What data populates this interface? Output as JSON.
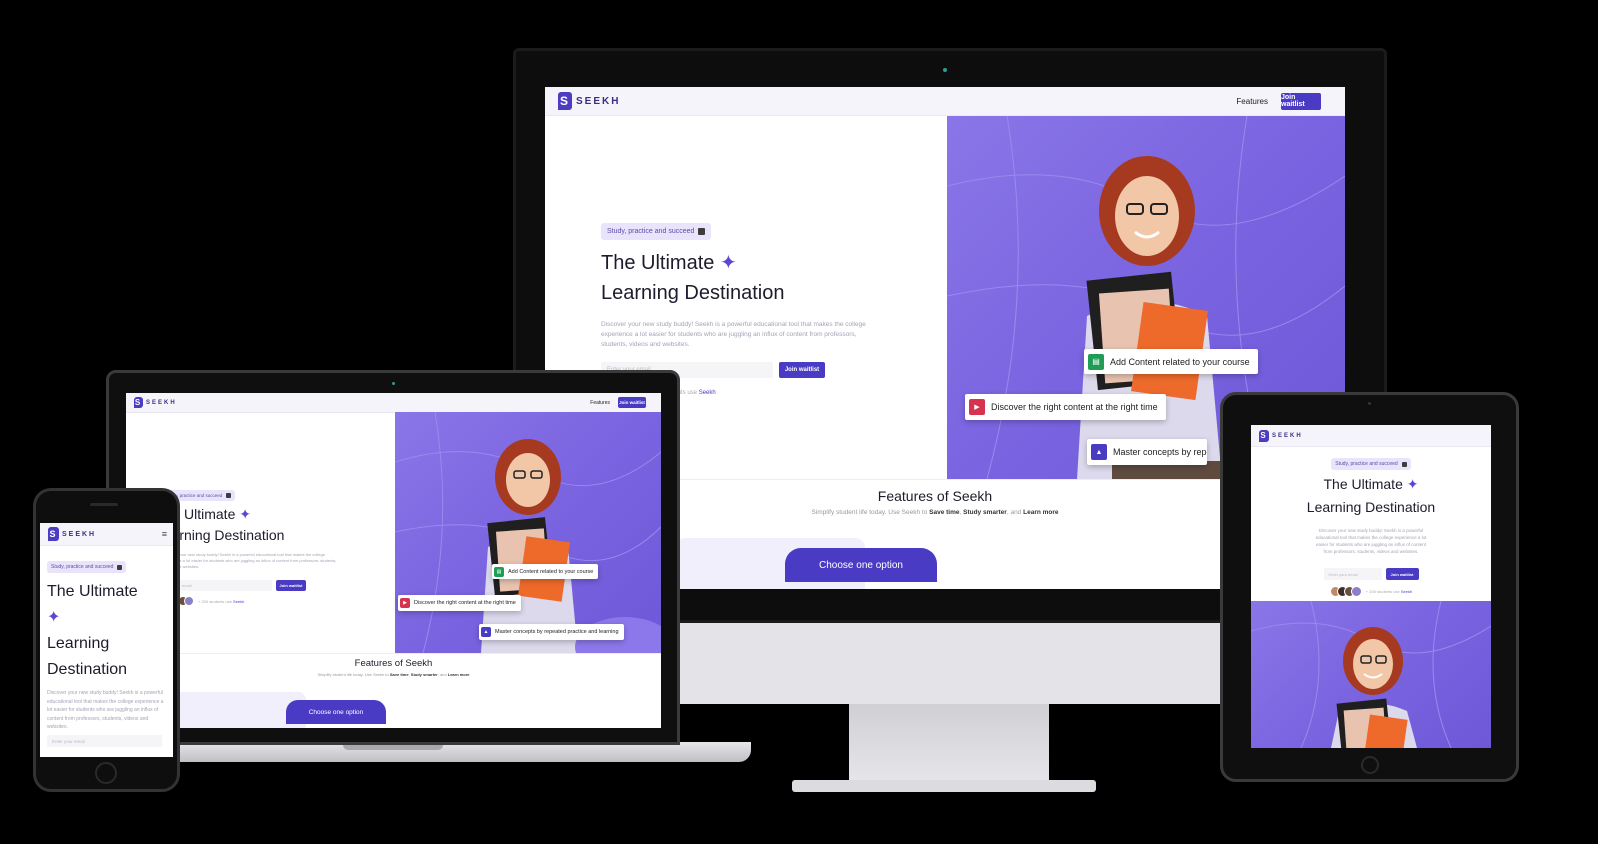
{
  "brand": {
    "mark": "S",
    "name": "SEEKH"
  },
  "nav": {
    "features": "Features",
    "join_button": "Join waitlist",
    "menu_icon": "hamburger-icon"
  },
  "hero": {
    "pill": "Study, practice and succeed",
    "pill_icon": "book-icon",
    "title_line1": "The Ultimate",
    "title_line2": "Learning Destination",
    "title_word_learning": "Learning",
    "title_word_destination": "Destination",
    "star_glyph": "✦",
    "description": "Discover your new study buddy! Seekh is a powerful educational tool that makes the college experience a lot easier for students who are juggling an influx of content from professors, students, videos and websites.",
    "email_placeholder": "Enter your email",
    "join_button": "Join waitlist",
    "students_prefix": "+ 200 students use",
    "students_brand": "Seekh",
    "students_partial": "dents use",
    "laptop_placeholder_fragment": "email"
  },
  "cards": {
    "add_content": "Add Content related to your course",
    "discover": "Discover the right content at the right time",
    "master": "Master concepts by repeated practice and learning",
    "master_cut": "Master concepts by repea"
  },
  "features": {
    "title": "Features of Seekh",
    "subtitle_prefix": "Simplify student life today. Use Seekh to",
    "save_time": "Save time",
    "study_smarter": "Study smarter",
    "and": "and",
    "learn_more": "Learn more",
    "choose_button": "Choose one option"
  },
  "colors": {
    "accent": "#4a3bc4",
    "hero_bg": "#7a64e0",
    "pill_bg": "#e9e4fb",
    "green": "#1f9d55",
    "red": "#d6334f"
  }
}
